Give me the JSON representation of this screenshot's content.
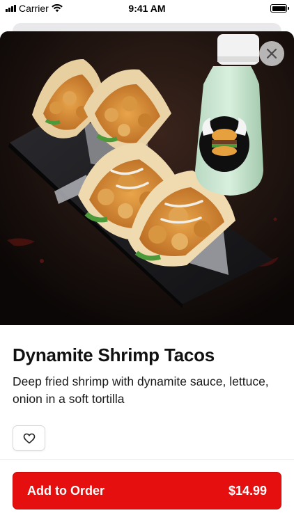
{
  "status_bar": {
    "carrier": "Carrier",
    "time": "9:41 AM"
  },
  "product": {
    "name": "Dynamite Shrimp Tacos",
    "description": "Deep fried shrimp with dynamite sauce, lettuce, onion in a soft tortilla",
    "price": "$14.99"
  },
  "actions": {
    "add_label": "Add to Order",
    "close_icon": "close-icon",
    "favorite_icon": "heart-icon"
  },
  "colors": {
    "accent": "#e50f0f",
    "text": "#111111",
    "background": "#ffffff"
  }
}
